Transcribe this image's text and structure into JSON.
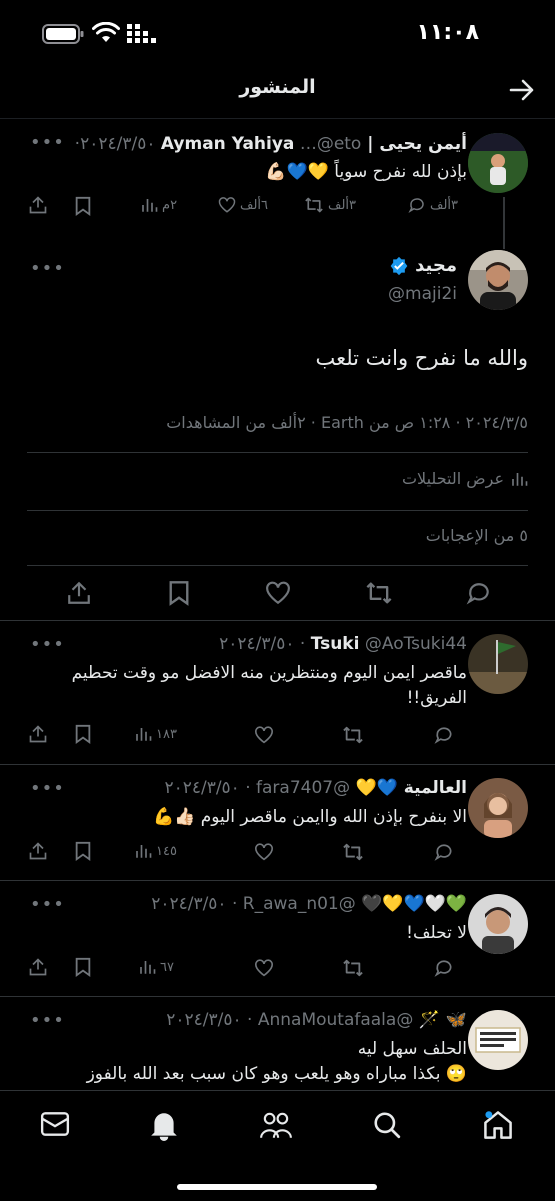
{
  "status": {
    "time": "١١:٠٨"
  },
  "header": {
    "title": "المنشور"
  },
  "parent_tweet": {
    "name": "أيمن يحيى | Ayman Yahiya",
    "handle_date": "…@eto ٢٠٢٤/٣/٥٠·",
    "text": "بإذن لله نفرح سوياً 💛💙💪🏻",
    "replies": "٣ألف",
    "retweets": "٣ألف",
    "likes": "٦ألف",
    "views": "٢م"
  },
  "main_tweet": {
    "name": "مجيد",
    "handle": "@maji2i",
    "text": "والله ما نفرح وانت تلعب",
    "meta": "٢٠٢٤/٣/٥ · ١:٢٨ ص من Earth · ٢ألف من المشاهدات",
    "analytics": "عرض التحليلات",
    "likes_line": "٥ من الإعجابات"
  },
  "replies": [
    {
      "name": "Tsuki",
      "handle_date": "@AoTsuki44 · ٢٠٢٤/٣/٥٠",
      "text": "ماقصر ايمن اليوم ومنتظرين منه الافضل مو وقت تحطيم الفريق!!",
      "views": "١٨٣"
    },
    {
      "name": "العالمية 💙💛",
      "handle_date": "@fara7407 · ٢٠٢٤/٣/٥٠",
      "text": "الا بنفرح  بإذن الله واايمن ماقصر اليوم 👍🏻💪",
      "views": "١٤٥"
    },
    {
      "name": "💚🤍💙💛🖤",
      "handle_date": "@R_awa_n01 · ٢٠٢٤/٣/٥٠",
      "text": "لا تحلف!",
      "views": "٦٧"
    },
    {
      "name": "🦋 🪄",
      "handle_date": "@AnnaMoutafaala · ٢٠٢٤/٣/٥٠",
      "text": "الحلف سهل ليه\n🙄 بكذا مباراه وهو يلعب وهو كان سبب بعد الله بالفوز",
      "views": ""
    }
  ],
  "tabbar": {
    "items": [
      "home-icon",
      "search-icon",
      "communities-icon",
      "notifications-icon",
      "messages-icon"
    ]
  }
}
